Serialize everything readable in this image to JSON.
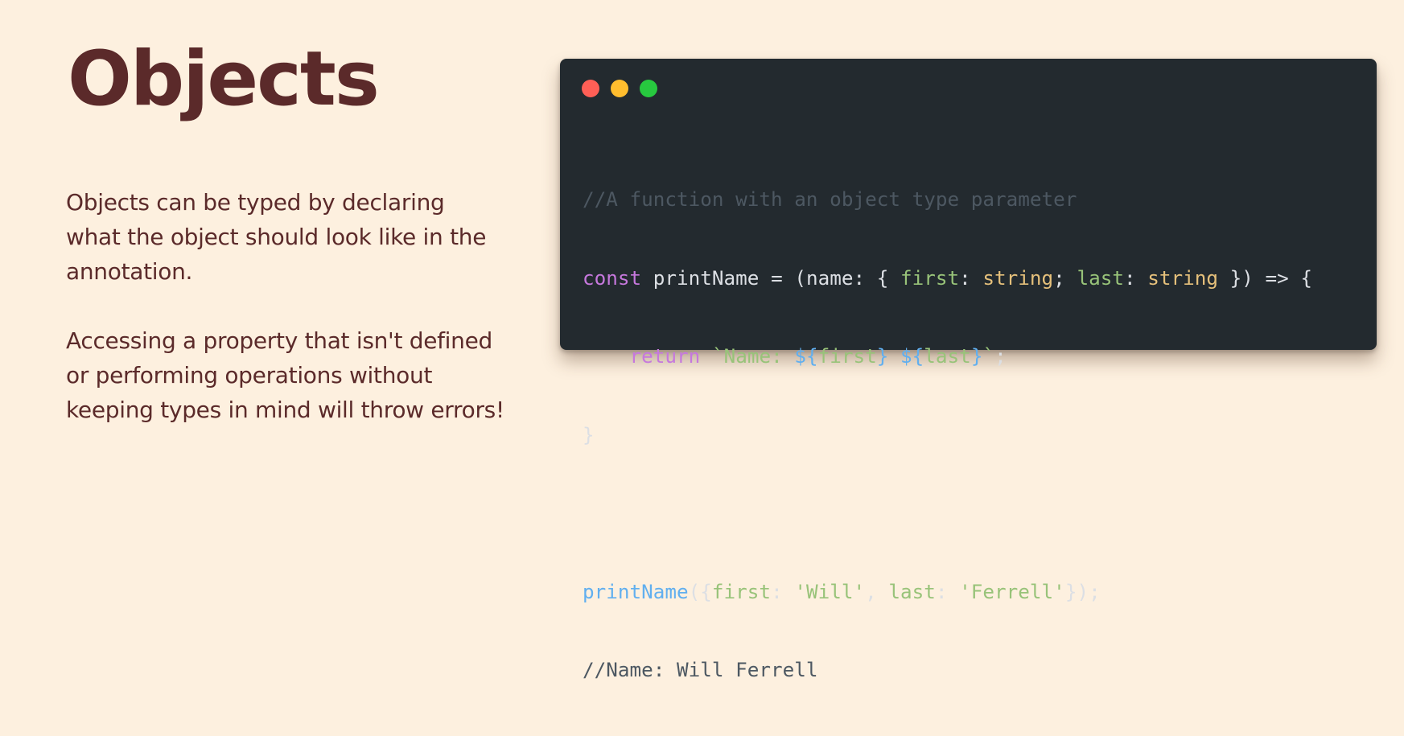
{
  "slide": {
    "title": "Objects",
    "paragraph1": {
      "lines": [
        "Objects can be typed by declaring",
        "what the object should look like in the",
        "annotation."
      ]
    },
    "paragraph2": {
      "lines": [
        "Accessing a property that isn't defined",
        "or performing operations without",
        "keeping types in mind will throw errors!"
      ]
    }
  },
  "code_window": {
    "window_buttons": [
      "close",
      "minimize",
      "maximize"
    ],
    "code": {
      "line1": {
        "comment": "//A function with an object type parameter"
      },
      "line2": {
        "kw_const": "const",
        "ident": " printName ",
        "eq": "= (",
        "param": "name",
        "p1": ": { ",
        "prop_first": "first",
        "p2": ": ",
        "type_string1": "string",
        "p3": "; ",
        "prop_last": "last",
        "p4": ": ",
        "type_string2": "string",
        "p5": " }) => {"
      },
      "line3": {
        "indent": "    ",
        "kw_return": "return",
        "sp": " ",
        "tpl_start": "`Name: ",
        "interp1_open": "${",
        "interp1_name": "first",
        "interp1_close": "}",
        "tpl_mid": " ",
        "interp2_open": "${",
        "interp2_name": "last",
        "interp2_close": "}",
        "tpl_end": "`",
        "semi": ";"
      },
      "line4": {
        "brace": "}"
      },
      "line5": {
        "blank": ""
      },
      "line6": {
        "func": "printName",
        "p1": "({",
        "key_first": "first",
        "p2": ": ",
        "val_will": "'Will'",
        "p3": ", ",
        "key_last": "last",
        "p4": ": ",
        "val_ferrell": "'Ferrell'",
        "p5": "});"
      },
      "line7": {
        "comment": "//Name: Will Ferrell"
      }
    }
  },
  "colors": {
    "background": "#fdf0df",
    "text": "#5b2a2a",
    "code_background": "#232a2f"
  }
}
